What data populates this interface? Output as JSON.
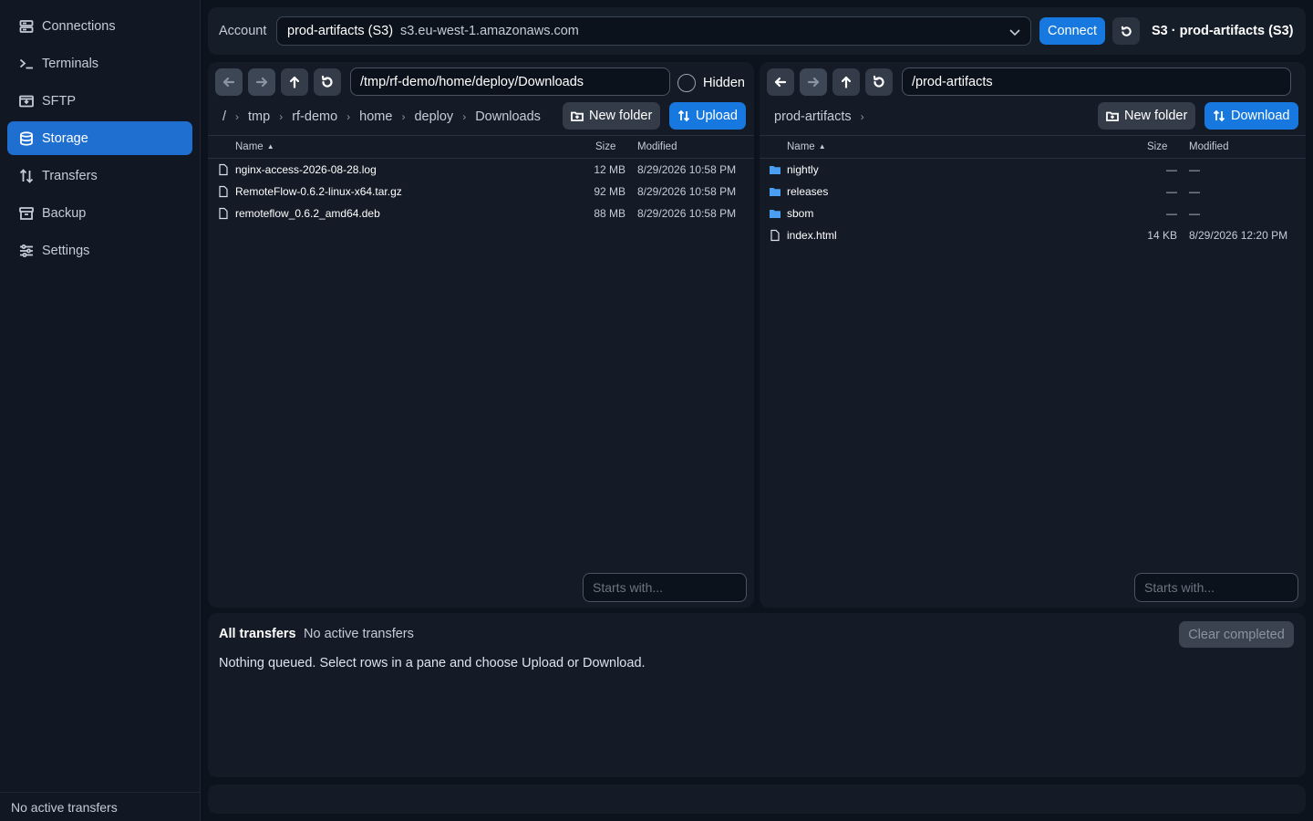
{
  "sidebar": {
    "items": [
      {
        "label": "Connections",
        "icon": "connections-icon",
        "active": false
      },
      {
        "label": "Terminals",
        "icon": "terminal-icon",
        "active": false
      },
      {
        "label": "SFTP",
        "icon": "sftp-icon",
        "active": false
      },
      {
        "label": "Storage",
        "icon": "storage-icon",
        "active": true
      },
      {
        "label": "Transfers",
        "icon": "transfers-icon",
        "active": false
      },
      {
        "label": "Backup",
        "icon": "backup-icon",
        "active": false
      },
      {
        "label": "Settings",
        "icon": "settings-icon",
        "active": false
      }
    ],
    "footer": "No active transfers"
  },
  "account_bar": {
    "label": "Account",
    "selected_name": "prod-artifacts (S3)",
    "selected_host": "s3.eu-west-1.amazonaws.com",
    "connect_label": "Connect",
    "status": "S3 · prod-artifacts (S3)"
  },
  "left_pane": {
    "path": "/tmp/rf-demo/home/deploy/Downloads",
    "hidden_label": "Hidden",
    "breadcrumbs": [
      "/",
      "tmp",
      "rf-demo",
      "home",
      "deploy",
      "Downloads"
    ],
    "new_folder_label": "New folder",
    "action_label": "Upload",
    "columns": {
      "name": "Name",
      "size": "Size",
      "modified": "Modified"
    },
    "rows": [
      {
        "type": "file",
        "name": "nginx-access-2026-08-28.log",
        "size": "12 MB",
        "modified": "8/29/2026 10:58 PM"
      },
      {
        "type": "file",
        "name": "RemoteFlow-0.6.2-linux-x64.tar.gz",
        "size": "92 MB",
        "modified": "8/29/2026 10:58 PM"
      },
      {
        "type": "file",
        "name": "remoteflow_0.6.2_amd64.deb",
        "size": "88 MB",
        "modified": "8/29/2026 10:58 PM"
      }
    ],
    "filter_placeholder": "Starts with..."
  },
  "right_pane": {
    "path": "/prod-artifacts",
    "breadcrumbs": [
      "prod-artifacts"
    ],
    "new_folder_label": "New folder",
    "action_label": "Download",
    "columns": {
      "name": "Name",
      "size": "Size",
      "modified": "Modified"
    },
    "rows": [
      {
        "type": "folder",
        "name": "nightly",
        "size": "—",
        "modified": "—"
      },
      {
        "type": "folder",
        "name": "releases",
        "size": "—",
        "modified": "—"
      },
      {
        "type": "folder",
        "name": "sbom",
        "size": "—",
        "modified": "—"
      },
      {
        "type": "file",
        "name": "index.html",
        "size": "14 KB",
        "modified": "8/29/2026 12:20 PM"
      }
    ],
    "filter_placeholder": "Starts with..."
  },
  "transfers": {
    "title": "All transfers",
    "status": "No active transfers",
    "clear_label": "Clear completed",
    "empty_message": "Nothing queued. Select rows in a pane and choose Upload or Download."
  },
  "colors": {
    "accent": "#1779e0",
    "active_nav": "#1f6fd1",
    "folder": "#4a9ff5",
    "background": "#0d131d",
    "panel": "#141b26"
  }
}
